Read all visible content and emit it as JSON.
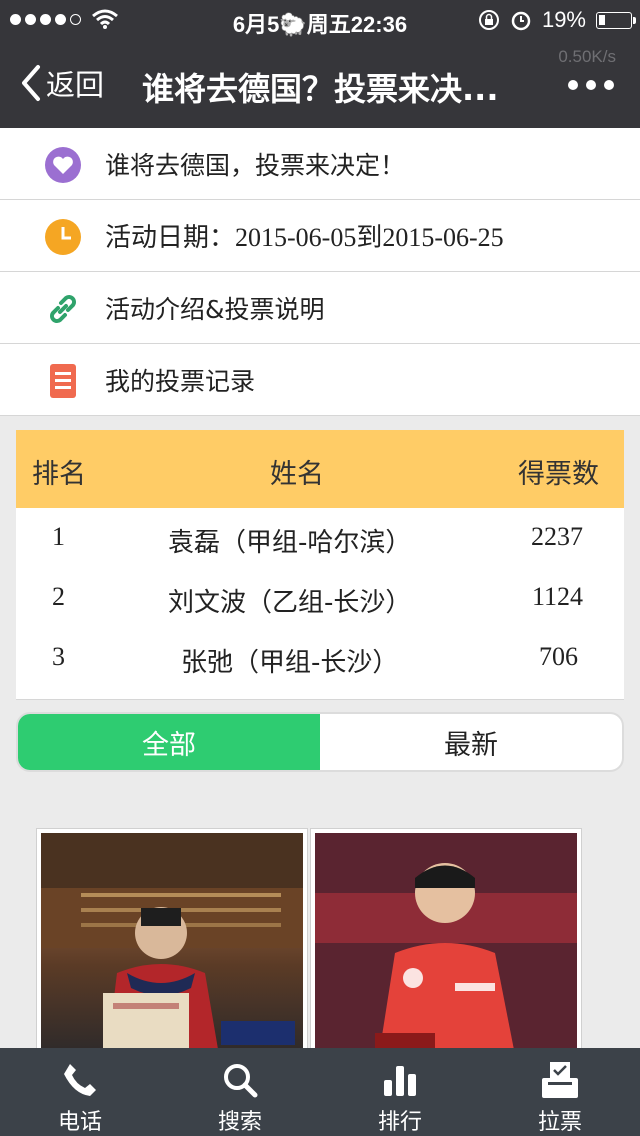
{
  "status_bar": {
    "time": "6月5🐑周五22:36",
    "battery": "19%",
    "battery_level": 0.19
  },
  "nav": {
    "back_label": "返回",
    "title": "谁将去德国？投票来决...",
    "speed": "0.50K/s"
  },
  "info_rows": [
    {
      "icon": "heart-icon",
      "text": "谁将去德国，投票来决定！"
    },
    {
      "icon": "clock-icon",
      "text": "活动日期：2015-06-05到2015-06-25"
    },
    {
      "icon": "link-icon",
      "text": "活动介绍&投票说明"
    },
    {
      "icon": "list-icon",
      "text": "我的投票记录"
    }
  ],
  "rank_table": {
    "headers": {
      "rank": "排名",
      "name": "姓名",
      "votes": "得票数"
    },
    "rows": [
      {
        "rank": "1",
        "name": "袁磊（甲组-哈尔滨）",
        "votes": "2237"
      },
      {
        "rank": "2",
        "name": "刘文波（乙组-长沙）",
        "votes": "1124"
      },
      {
        "rank": "3",
        "name": "张弛（甲组-长沙）",
        "votes": "706"
      }
    ]
  },
  "segment": {
    "all": "全部",
    "latest": "最新",
    "active": "all"
  },
  "tabbar": [
    {
      "icon": "phone-icon",
      "label": "电话"
    },
    {
      "icon": "search-icon",
      "label": "搜索"
    },
    {
      "icon": "bar-chart-icon",
      "label": "排行"
    },
    {
      "icon": "ballot-box-icon",
      "label": "拉票"
    }
  ],
  "colors": {
    "nav_bg": "#36363a",
    "table_header": "#ffcc66",
    "accent_green": "#2ecc71",
    "tabbar_bg": "#3c4249"
  }
}
